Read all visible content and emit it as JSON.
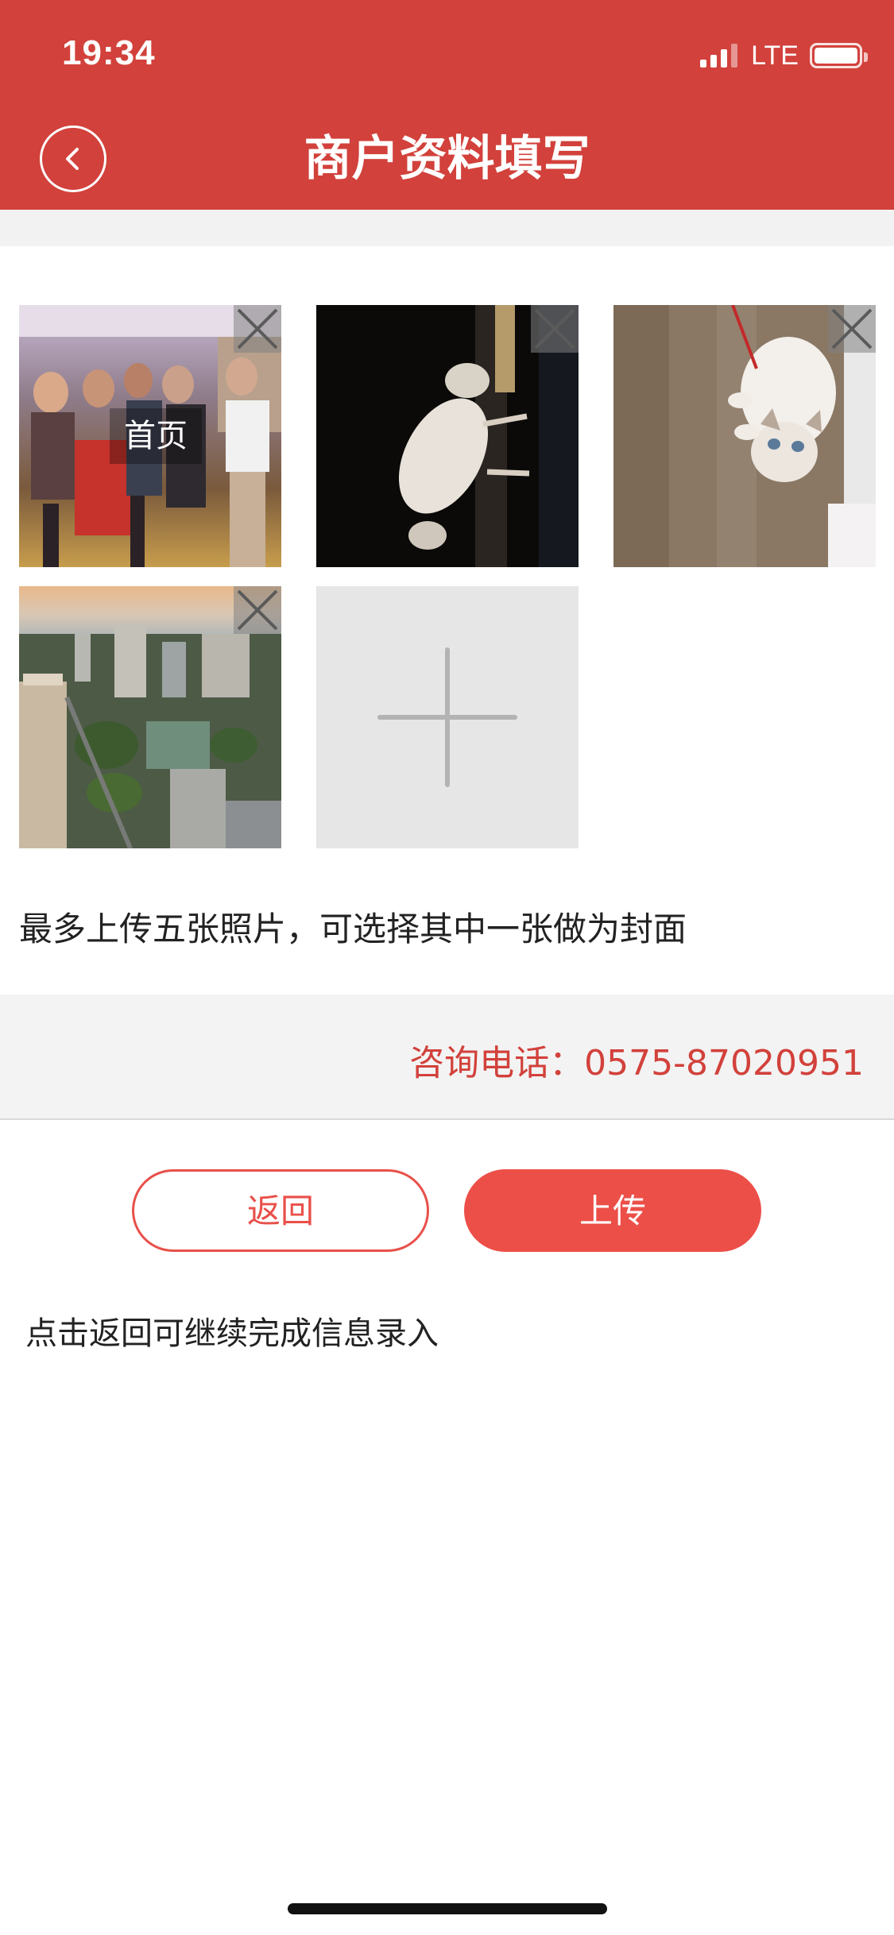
{
  "status_bar": {
    "time": "19:34",
    "network": "LTE",
    "signal_bars": 4,
    "signal_bars_active": 3,
    "battery_level": 1.0
  },
  "header": {
    "title": "商户资料填写",
    "back_icon": "chevron-left-icon",
    "background_color": "#d2413b"
  },
  "photos": {
    "items": [
      {
        "subject": "group of people at a party",
        "is_cover": true,
        "cover_label": "首页",
        "delete_icon": "close-icon"
      },
      {
        "subject": "white dog in dark room",
        "is_cover": false,
        "delete_icon": "close-icon"
      },
      {
        "subject": "white kitten on wooden floor",
        "is_cover": false,
        "delete_icon": "close-icon"
      },
      {
        "subject": "city skyline at sunset",
        "is_cover": false,
        "delete_icon": "close-icon"
      }
    ],
    "add_icon": "plus-icon",
    "hint": "最多上传五张照片，可选择其中一张做为封面"
  },
  "contact": {
    "text": "咨询电话：0575-87020951",
    "color": "#d2413b"
  },
  "actions": {
    "back_label": "返回",
    "upload_label": "上传",
    "accent_color": "#ec4f48"
  },
  "footer_hint": "点击返回可继续完成信息录入"
}
